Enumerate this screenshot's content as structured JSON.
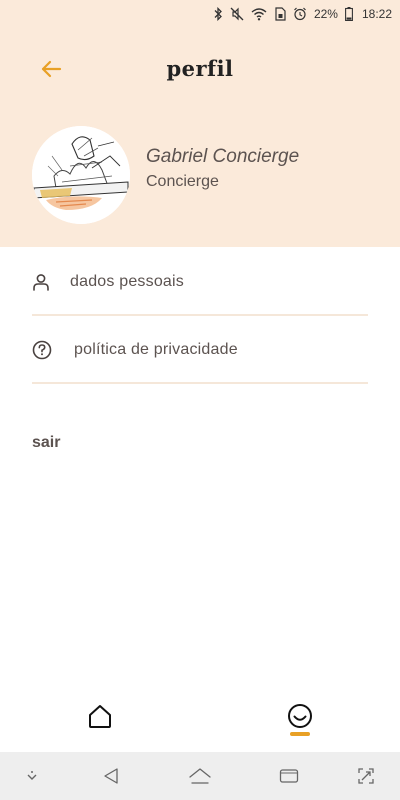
{
  "status_bar": {
    "battery_percent": "22%",
    "time": "18:22"
  },
  "header": {
    "title": "perfil",
    "back_icon": "arrow-left-icon",
    "accent_color": "#e8a025",
    "background_color": "#fbeada"
  },
  "profile": {
    "name": "Gabriel Concierge",
    "role": "Concierge"
  },
  "menu": {
    "items": [
      {
        "label": "dados pessoais",
        "icon": "user-icon"
      },
      {
        "label": "política de privacidade",
        "icon": "question-circle-icon"
      }
    ]
  },
  "logout_label": "sair",
  "bottom_nav": {
    "items": [
      {
        "icon": "home-icon",
        "active": false
      },
      {
        "icon": "smile-icon",
        "active": true
      }
    ]
  },
  "system_nav": {
    "icons": [
      "chevron-down-icon",
      "back-triangle-icon",
      "home-icon",
      "recents-icon",
      "screenshot-icon"
    ]
  }
}
